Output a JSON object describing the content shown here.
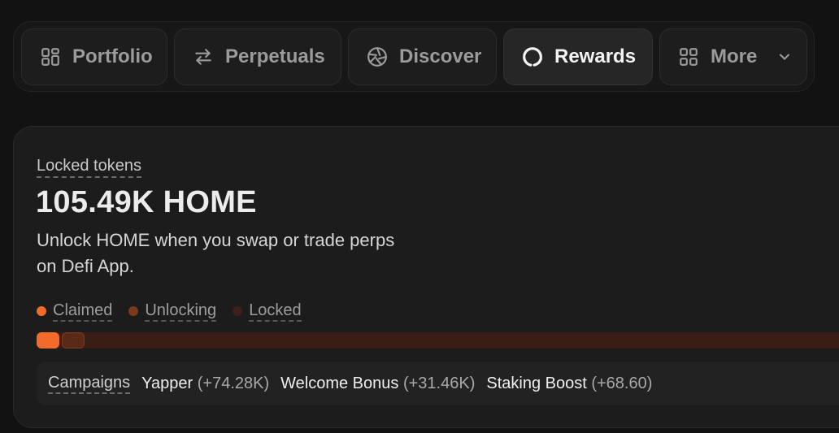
{
  "nav": {
    "items": [
      {
        "label": "Portfolio",
        "icon": "grid-icon",
        "active": false
      },
      {
        "label": "Perpetuals",
        "icon": "swap-arrows-icon",
        "active": false
      },
      {
        "label": "Discover",
        "icon": "aperture-icon",
        "active": false
      },
      {
        "label": "Rewards",
        "icon": "ring-icon",
        "active": true
      },
      {
        "label": "More",
        "icon": "grid-icon",
        "active": false
      }
    ]
  },
  "rewards": {
    "locked_label": "Locked tokens",
    "amount": "105.49K HOME",
    "description": "Unlock HOME when you swap or trade perps on Defi App.",
    "legend": [
      {
        "label": "Claimed",
        "color": "#f26b2a"
      },
      {
        "label": "Unlocking",
        "color": "#7a3a1e"
      },
      {
        "label": "Locked",
        "color": "#3d2118"
      }
    ],
    "progress": {
      "claimed_fraction": 0.027,
      "unlocking_fraction": 0.027
    },
    "campaigns": {
      "label": "Campaigns",
      "items": [
        {
          "name": "Yapper",
          "delta": "(+74.28K)"
        },
        {
          "name": "Welcome Bonus",
          "delta": "(+31.46K)"
        },
        {
          "name": "Staking Boost",
          "delta": "(+68.60)"
        }
      ]
    }
  },
  "colors": {
    "accent": "#f26b2a",
    "background": "#121212",
    "card": "#1c1c1c"
  }
}
